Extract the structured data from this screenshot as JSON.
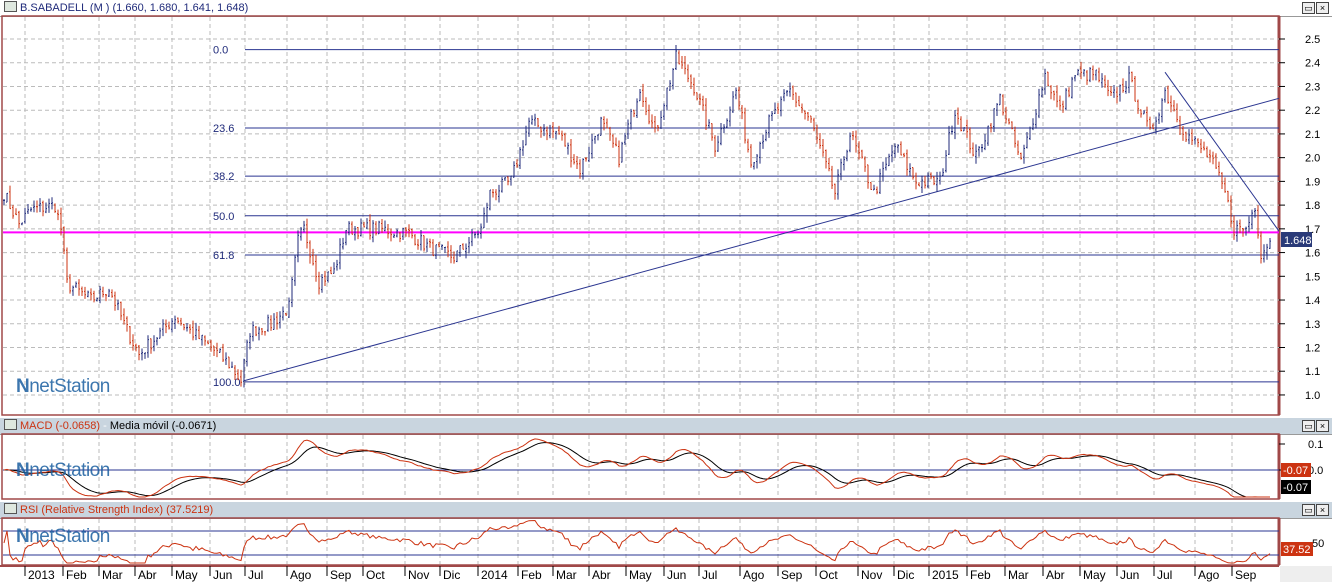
{
  "main": {
    "title": "B.SABADELL (M ) (1.660, 1.680, 1.641, 1.648)",
    "last_price": "1.648"
  },
  "macd": {
    "title_macd": "MACD (-0.0658)",
    "title_sep": " - ",
    "title_ma": "Media móvil (-0.0671)",
    "label_macd": "-0.07",
    "label_signal": "-0.07"
  },
  "rsi": {
    "title": "RSI (Relative Strength Index) (37.5219)",
    "label_value": "37.52"
  },
  "logo": {
    "text_n": "N",
    "text": "netStation"
  },
  "colors": {
    "up": "#1f2a7a",
    "down": "#cc3311",
    "fib": "#2a3590",
    "support": "#ff00ff",
    "frame": "#a04848"
  },
  "chart_data": {
    "type": "ohlc",
    "title": "B.SABADELL (M )",
    "ylim": [
      0.95,
      2.58
    ],
    "yticks": [
      1.0,
      1.1,
      1.2,
      1.3,
      1.4,
      1.5,
      1.6,
      1.7,
      1.8,
      1.9,
      2.0,
      2.1,
      2.2,
      2.3,
      2.4,
      2.5
    ],
    "fib_levels": [
      {
        "label": "0.0",
        "price": 2.455
      },
      {
        "label": "23.6",
        "price": 2.125
      },
      {
        "label": "38.2",
        "price": 1.922
      },
      {
        "label": "50.0",
        "price": 1.755
      },
      {
        "label": "61.8",
        "price": 1.59
      },
      {
        "label": "100.0",
        "price": 1.055
      }
    ],
    "support_line": 1.685,
    "trendlines": [
      {
        "from": {
          "bar": 80,
          "price": 1.06
        },
        "to": {
          "bar": 425,
          "price": 2.25
        }
      },
      {
        "from": {
          "bar": 387,
          "price": 2.36
        },
        "to": {
          "bar": 425,
          "price": 1.69
        }
      }
    ],
    "price_keypoints": [
      [
        0,
        1.85
      ],
      [
        5,
        1.72
      ],
      [
        9,
        1.78
      ],
      [
        17,
        1.8
      ],
      [
        19,
        1.7
      ],
      [
        21,
        1.47
      ],
      [
        29,
        1.4
      ],
      [
        35,
        1.45
      ],
      [
        40,
        1.3
      ],
      [
        45,
        1.17
      ],
      [
        52,
        1.26
      ],
      [
        57,
        1.33
      ],
      [
        62,
        1.27
      ],
      [
        69,
        1.2
      ],
      [
        75,
        1.13
      ],
      [
        79,
        1.06
      ],
      [
        82,
        1.27
      ],
      [
        89,
        1.3
      ],
      [
        95,
        1.37
      ],
      [
        98,
        1.65
      ],
      [
        100,
        1.7
      ],
      [
        105,
        1.48
      ],
      [
        110,
        1.52
      ],
      [
        114,
        1.7
      ],
      [
        125,
        1.7
      ],
      [
        135,
        1.68
      ],
      [
        142,
        1.62
      ],
      [
        150,
        1.58
      ],
      [
        159,
        1.7
      ],
      [
        162,
        1.85
      ],
      [
        169,
        1.9
      ],
      [
        175,
        2.15
      ],
      [
        185,
        2.1
      ],
      [
        192,
        1.95
      ],
      [
        199,
        2.15
      ],
      [
        205,
        2.0
      ],
      [
        212,
        2.3
      ],
      [
        217,
        2.1
      ],
      [
        224,
        2.42
      ],
      [
        230,
        2.3
      ],
      [
        237,
        2.05
      ],
      [
        244,
        2.28
      ],
      [
        249,
        1.98
      ],
      [
        255,
        2.15
      ],
      [
        262,
        2.28
      ],
      [
        269,
        2.15
      ],
      [
        277,
        1.85
      ],
      [
        282,
        2.1
      ],
      [
        290,
        1.85
      ],
      [
        297,
        2.05
      ],
      [
        304,
        1.9
      ],
      [
        312,
        1.9
      ],
      [
        317,
        2.2
      ],
      [
        324,
        2.0
      ],
      [
        332,
        2.25
      ],
      [
        339,
        1.98
      ],
      [
        347,
        2.35
      ],
      [
        352,
        2.2
      ],
      [
        357,
        2.35
      ],
      [
        364,
        2.35
      ],
      [
        369,
        2.25
      ],
      [
        375,
        2.33
      ],
      [
        382,
        2.1
      ],
      [
        387,
        2.28
      ],
      [
        394,
        2.1
      ],
      [
        402,
        2.0
      ],
      [
        407,
        1.85
      ],
      [
        410,
        1.7
      ],
      [
        414,
        1.7
      ],
      [
        417,
        1.8
      ],
      [
        419,
        1.6
      ],
      [
        422,
        1.648
      ]
    ],
    "x_labels": [
      "2013",
      "Feb",
      "Mar",
      "Abr",
      "May",
      "Jun",
      "Jul",
      "Ago",
      "Sep",
      "Oct",
      "Nov",
      "Dic",
      "2014",
      "Feb",
      "Mar",
      "Abr",
      "May",
      "Jun",
      "Jul",
      "Ago",
      "Sep",
      "Oct",
      "Nov",
      "Dic",
      "2015",
      "Feb",
      "Mar",
      "Abr",
      "May",
      "Jun",
      "Jul",
      "Ago",
      "Sep"
    ],
    "macd_yticks": [
      {
        "label": "0.1",
        "value": 0.1
      },
      {
        "label": "0.0",
        "value": 0.0
      }
    ],
    "rsi_yticks": [
      {
        "label": "50",
        "value": 50
      }
    ],
    "rsi_levels": [
      70,
      30
    ]
  }
}
